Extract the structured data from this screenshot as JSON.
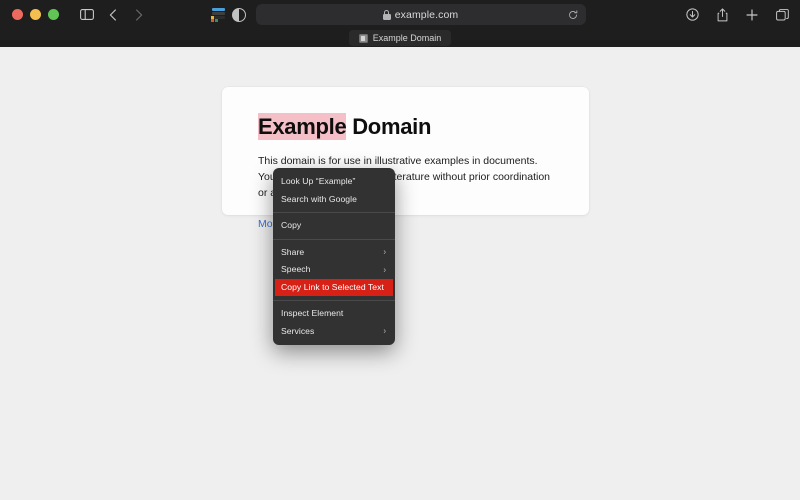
{
  "browser": {
    "window_controls": [
      {
        "name": "close",
        "color": "#ed6a5f"
      },
      {
        "name": "minimize",
        "color": "#f4bf50"
      },
      {
        "name": "maximize",
        "color": "#61c555"
      }
    ],
    "toolbar": {
      "sidebar_label": "Show sidebar",
      "back_label": "Back",
      "forward_label": "Forward",
      "extension_label": "Extension",
      "appearance_label": "Appearance",
      "downloads_label": "Downloads",
      "share_label": "Share",
      "new_tab_label": "New Tab",
      "tab_overview_label": "Tab Overview"
    },
    "address_bar": {
      "url": "example.com",
      "secure": true,
      "reload_label": "Reload"
    },
    "tabs": [
      {
        "title": "Example Domain",
        "active": true
      }
    ]
  },
  "page": {
    "heading_selected": "Example",
    "heading_rest": " Domain",
    "body": "This domain is for use in illustrative examples in documents. You may use this domain in literature without prior coordination or asking for permission.",
    "link": "More information...",
    "selection_color": "#f4bfc6",
    "link_color": "#3a6fd8"
  },
  "context_menu": {
    "highlight_color": "#d82116",
    "groups": [
      {
        "items": [
          {
            "label": "Look Up “Example”",
            "submenu": false,
            "highlighted": false
          },
          {
            "label": "Search with Google",
            "submenu": false,
            "highlighted": false
          }
        ]
      },
      {
        "items": [
          {
            "label": "Copy",
            "submenu": false,
            "highlighted": false
          }
        ]
      },
      {
        "items": [
          {
            "label": "Share",
            "submenu": true,
            "highlighted": false
          },
          {
            "label": "Speech",
            "submenu": true,
            "highlighted": false
          },
          {
            "label": "Copy Link to Selected Text",
            "submenu": false,
            "highlighted": true
          }
        ]
      },
      {
        "items": [
          {
            "label": "Inspect Element",
            "submenu": false,
            "highlighted": false
          },
          {
            "label": "Services",
            "submenu": true,
            "highlighted": false
          }
        ]
      }
    ]
  }
}
